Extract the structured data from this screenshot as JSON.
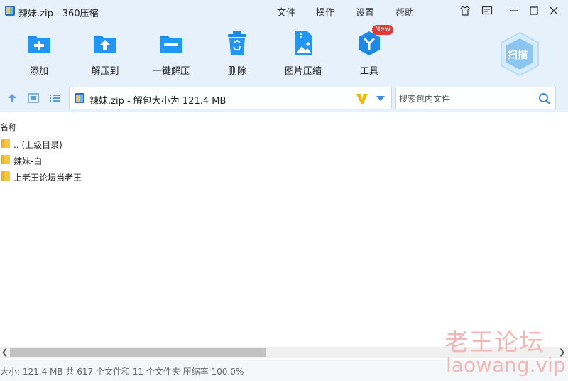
{
  "window": {
    "title": "辣妹.zip - 360压缩",
    "menu": [
      "文件",
      "操作",
      "设置",
      "帮助"
    ]
  },
  "toolbar": {
    "items": [
      {
        "label": "添加",
        "icon": "add-icon"
      },
      {
        "label": "解压到",
        "icon": "extract-to-icon"
      },
      {
        "label": "一键解压",
        "icon": "one-click-extract-icon"
      },
      {
        "label": "删除",
        "icon": "delete-icon"
      },
      {
        "label": "图片压缩",
        "icon": "image-compress-icon"
      },
      {
        "label": "工具",
        "icon": "tools-icon"
      }
    ],
    "new_badge": "New",
    "scan_label": "扫描"
  },
  "address": {
    "text": "辣妹.zip - 解包大小为 121.4 MB"
  },
  "search": {
    "placeholder": "搜索包内文件"
  },
  "list": {
    "column_name": "名称",
    "rows": [
      {
        "name": ".. (上级目录)"
      },
      {
        "name": "辣妹-白"
      },
      {
        "name": "上老王论坛当老王"
      }
    ]
  },
  "status": {
    "text": "大小: 121.4 MB 共 617 个文件和 11 个文件夹 压缩率 100.0%"
  },
  "watermark": {
    "line1": "老王论坛",
    "line2": "laowang.vip"
  },
  "colors": {
    "accent": "#1e88e5",
    "toolbar_bg": "#e6f1fc",
    "folder": "#f5c542",
    "badge": "#e53935"
  }
}
